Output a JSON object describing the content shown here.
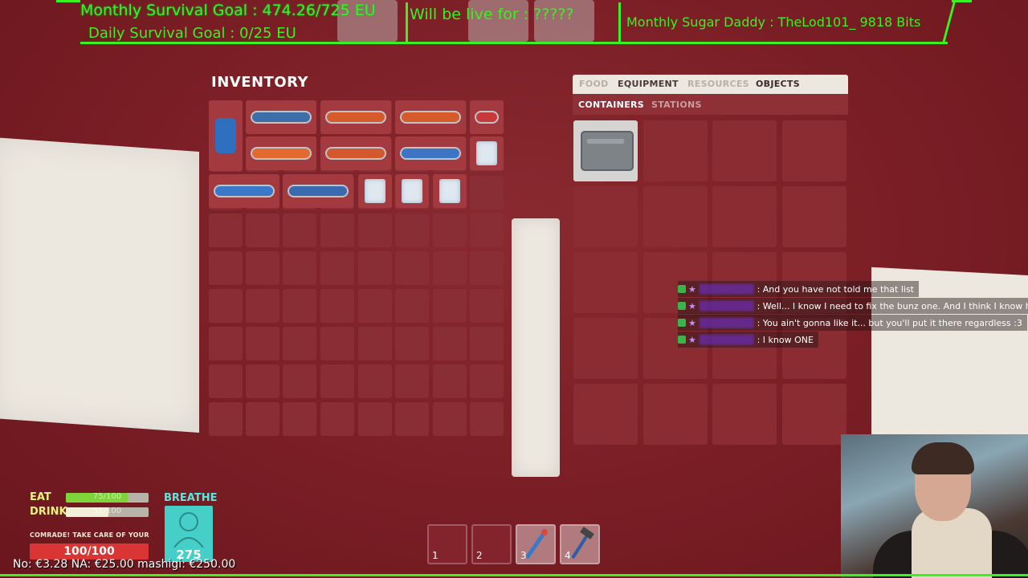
{
  "overlay": {
    "monthly_goal": "Monthly Survival Goal : 474.26/725 EU",
    "daily_goal": "Daily Survival Goal : 0/25 EU",
    "live_for": "Will be live for :   ?????",
    "sugar_daddy": "Monthly Sugar Daddy : TheLod101_ 9818 Bits"
  },
  "inventory": {
    "title": "INVENTORY",
    "items": [
      {
        "name": "blue-canister-icon"
      },
      {
        "name": "heavy-gun-icon"
      },
      {
        "name": "orange-blaster-icon"
      },
      {
        "name": "orange-pistol-icon"
      },
      {
        "name": "red-can-icon"
      },
      {
        "name": "orange-device-icon"
      },
      {
        "name": "drill-gun-icon"
      },
      {
        "name": "blue-wrench-icon"
      },
      {
        "name": "ice-bag-icon"
      },
      {
        "name": "long-rifle-icon"
      },
      {
        "name": "blaster-rifle-icon"
      },
      {
        "name": "ice-bag-icon"
      },
      {
        "name": "ice-bag-icon"
      },
      {
        "name": "ice-bag-icon"
      }
    ]
  },
  "crafting": {
    "tabs": [
      "FOOD",
      "EQUIPMENT",
      "RESOURCES",
      "OBJECTS"
    ],
    "subtabs": [
      "CONTAINERS",
      "STATIONS"
    ],
    "active_tab": "OBJECTS",
    "active_subtab": "CONTAINERS",
    "first_item": "toolbox-icon"
  },
  "chat": [
    {
      "message": ": And you have not told me that list"
    },
    {
      "message": ": Well... I know I need to fix the bunz one. And I think I know how"
    },
    {
      "message": ": You ain't gonna like it... but you'll put it there regardless :3"
    },
    {
      "message": ": I know ONE"
    }
  ],
  "hud": {
    "eat_label": "EAT",
    "eat_value": "75/100",
    "eat_fraction": 0.75,
    "drink_label": "DRINK",
    "drink_value": "51/100",
    "drink_fraction": 0.51,
    "breathe_label": "BREATHE",
    "breathe_value": "275",
    "comrade_text": "COMRADE! TAKE CARE OF YOUR",
    "health_value": "100/100",
    "donations": "No: €3.28   NA: €25.00   mashigi: €250.00"
  },
  "hotbar": [
    {
      "number": "1",
      "item": ""
    },
    {
      "number": "2",
      "item": ""
    },
    {
      "number": "3",
      "item": "blue-wrench-icon"
    },
    {
      "number": "4",
      "item": "hammer-icon"
    }
  ],
  "colors": {
    "background": "#7c1f26",
    "overlay_green": "#39f21f",
    "eat_green": "#7fd43a",
    "breathe_teal": "#45cfc8",
    "health_red": "#d93535"
  }
}
